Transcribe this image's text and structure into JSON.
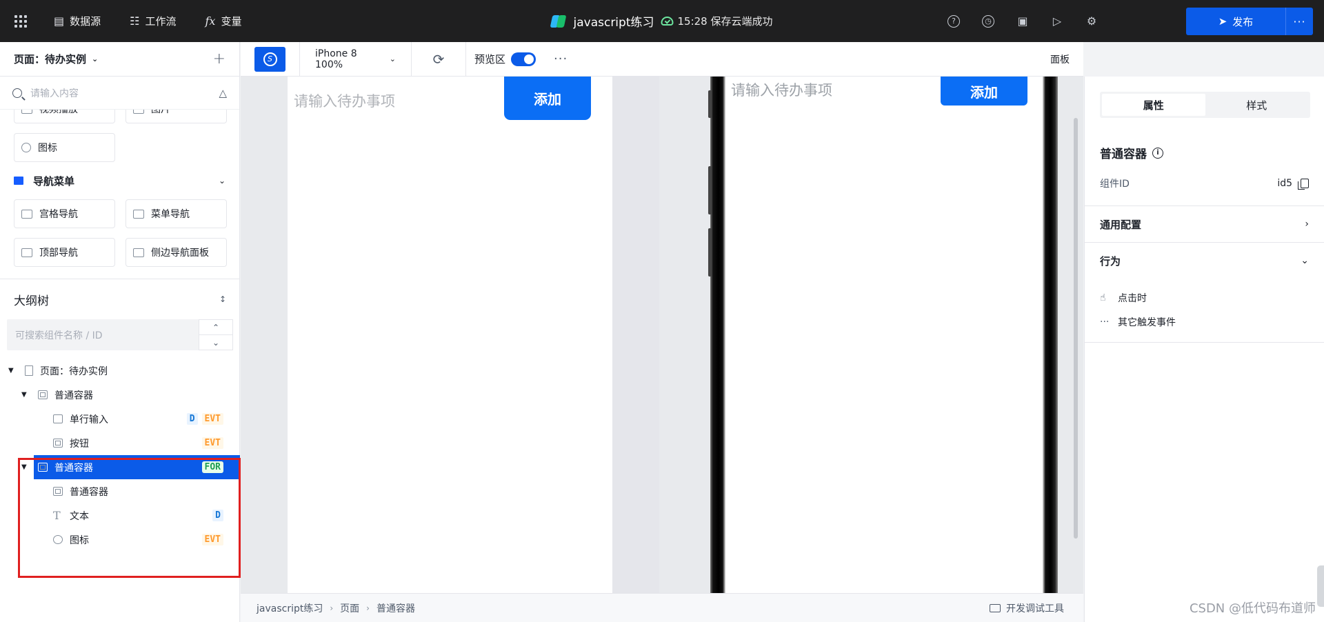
{
  "topbar": {
    "nav": [
      {
        "label": "数据源",
        "icon": "database-icon"
      },
      {
        "label": "工作流",
        "icon": "workflow-icon"
      },
      {
        "label": "变量",
        "icon": "fx-icon"
      }
    ],
    "app_title": "javascript练习",
    "save_status": "15:28 保存云端成功",
    "publish_label": "发布",
    "tools": [
      "help-icon",
      "history-icon",
      "save-icon",
      "play-icon",
      "debug-icon"
    ]
  },
  "left": {
    "page_name": "页面：待办实例",
    "search_placeholder": "请输入内容",
    "components_top": [
      {
        "label": "视频播放",
        "icon": "video-icon"
      },
      {
        "label": "图片",
        "icon": "image-icon"
      },
      {
        "label": "图标",
        "icon": "icon-component-icon"
      }
    ],
    "nav_section": "导航菜单",
    "nav_components": [
      {
        "label": "宫格导航",
        "icon": "grid-nav-icon"
      },
      {
        "label": "菜单导航",
        "icon": "menu-nav-icon"
      },
      {
        "label": "顶部导航",
        "icon": "top-nav-icon"
      },
      {
        "label": "侧边导航面板",
        "icon": "side-nav-icon"
      }
    ],
    "outline_title": "大纲树",
    "outline_search_placeholder": "可搜索组件名称 / ID",
    "tree": [
      {
        "label": "页面：待办实例",
        "level": 0,
        "icon": "page-icon",
        "expanded": true,
        "badges": []
      },
      {
        "label": "普通容器",
        "level": 1,
        "icon": "container-icon",
        "expanded": true,
        "badges": []
      },
      {
        "label": "单行输入",
        "level": 2,
        "icon": "input-icon",
        "badges": [
          "D",
          "EVT"
        ]
      },
      {
        "label": "按钮",
        "level": 2,
        "icon": "button-icon",
        "badges": [
          "EVT"
        ]
      },
      {
        "label": "普通容器",
        "level": 1,
        "icon": "container-icon",
        "expanded": true,
        "selected": true,
        "badges": [
          "FOR"
        ]
      },
      {
        "label": "普通容器",
        "level": 2,
        "icon": "container-icon",
        "badges": []
      },
      {
        "label": "文本",
        "level": 2,
        "icon": "text-icon",
        "badges": [
          "D"
        ]
      },
      {
        "label": "图标",
        "level": 2,
        "icon": "icon-component-icon",
        "badges": [
          "EVT"
        ]
      }
    ]
  },
  "toolbar": {
    "device": "iPhone 8 100%",
    "preview_label": "预览区",
    "preview_on": true,
    "panel_label": "面板"
  },
  "canvas": {
    "input_placeholder": "请输入待办事项",
    "add_button": "添加"
  },
  "breadcrumb": [
    "javascript练习",
    "页面",
    "普通容器"
  ],
  "devtools_label": "开发调试工具",
  "right": {
    "tabs": [
      "属性",
      "样式"
    ],
    "active_tab": "属性",
    "component_title": "普通容器",
    "component_id_label": "组件ID",
    "component_id": "id5",
    "general_config": "通用配置",
    "behavior": "行为",
    "events": [
      {
        "label": "点击时",
        "icon": "tap-icon"
      },
      {
        "label": "其它触发事件",
        "icon": "more-icon"
      }
    ]
  },
  "watermark": "CSDN @低代码布道师",
  "colors": {
    "brand": "#0b5be8",
    "button": "#0b6ef5",
    "topbar_bg": "#1f1f20",
    "highlight_frame": "#e02020",
    "badge_d": "#1677d6",
    "badge_evt": "#ff9a2e",
    "badge_for": "#1f9d55"
  }
}
